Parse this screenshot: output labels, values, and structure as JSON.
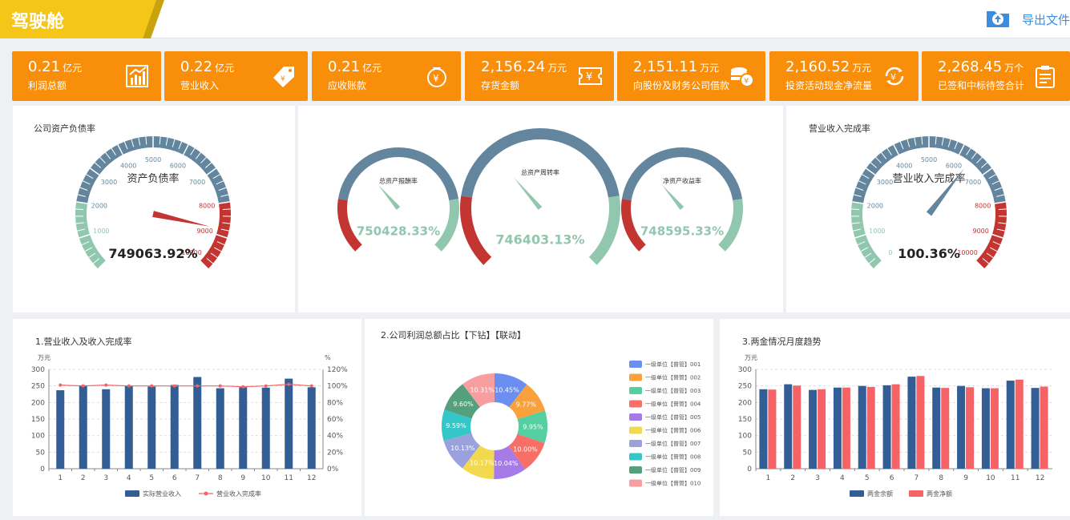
{
  "header": {
    "title": "驾驶舱",
    "export_label": "导出文件",
    "export_icon": "cloud-upload-icon"
  },
  "colors": {
    "accent": "#f98e0b",
    "title_tab": "#f5c518",
    "gauge_green": "#91c7ae",
    "gauge_blue": "#63869e",
    "gauge_red": "#c23531",
    "bar_blue": "#325d95",
    "bar_red": "#f56366"
  },
  "kpis": [
    {
      "value": "0.21",
      "unit": "亿元",
      "label": "利润总额",
      "icon": "bar-chart-icon"
    },
    {
      "value": "0.22",
      "unit": "亿元",
      "label": "营业收入",
      "icon": "price-tag-icon"
    },
    {
      "value": "0.21",
      "unit": "亿元",
      "label": "应收账款",
      "icon": "money-bag-icon"
    },
    {
      "value": "2,156.24",
      "unit": "万元",
      "label": "存货金额",
      "icon": "ticket-icon"
    },
    {
      "value": "2,151.11",
      "unit": "万元",
      "label": "向股份及财务公司借款",
      "icon": "coins-icon"
    },
    {
      "value": "2,160.52",
      "unit": "万元",
      "label": "投资活动现金净流量",
      "icon": "cycle-icon"
    },
    {
      "value": "2,268.45",
      "unit": "万个",
      "label": "已签和中标待签合计",
      "icon": "clipboard-icon"
    }
  ],
  "gauge_left": {
    "title": "公司资产负债率",
    "name": "资产负债率",
    "value_text": "749063.92%",
    "ticks": [
      "0",
      "1000",
      "2000",
      "3000",
      "4000",
      "5000",
      "6000",
      "7000",
      "8000",
      "9000",
      "10000"
    ],
    "pointer_fraction": 0.88
  },
  "gauge_center": [
    {
      "name": "总资产报酬率",
      "value_text": "750428.33%",
      "pointer_fraction": 0.35
    },
    {
      "name": "总资产周转率",
      "value_text": "746403.13%",
      "pointer_fraction": 0.35
    },
    {
      "name": "净资产收益率",
      "value_text": "748595.33%",
      "pointer_fraction": 0.35
    }
  ],
  "gauge_right": {
    "title": "营业收入完成率",
    "name": "营业收入完成率",
    "value_text": "100.36%",
    "ticks": [
      "0",
      "1000",
      "2000",
      "3000",
      "4000",
      "5000",
      "6000",
      "7000",
      "8000",
      "9000",
      "10000"
    ],
    "pointer_fraction": 0.64
  },
  "chart_data": [
    {
      "type": "bar",
      "title": "1.营业收入及收入完成率",
      "ylabel": "万元",
      "ylabel_right": "%",
      "categories": [
        "1",
        "2",
        "3",
        "4",
        "5",
        "6",
        "7",
        "8",
        "9",
        "10",
        "11",
        "12"
      ],
      "yticks": [
        "0",
        "50",
        "100",
        "150",
        "200",
        "250",
        "300"
      ],
      "yticks_right": [
        "0%",
        "20%",
        "40%",
        "60%",
        "80%",
        "100%",
        "120%"
      ],
      "ylim": [
        0,
        300
      ],
      "ylim_right": [
        0,
        120
      ],
      "series": [
        {
          "name": "实际营业收入",
          "values": [
            237,
            252,
            240,
            250,
            248,
            253,
            277,
            243,
            246,
            245,
            272,
            246
          ]
        },
        {
          "name": "营业收入完成率",
          "values": [
            101,
            100,
            101,
            100,
            100,
            100,
            100,
            100,
            99,
            100,
            102,
            100
          ]
        }
      ],
      "legend": "bottom"
    },
    {
      "type": "pie",
      "title": "2.公司利润总额占比【下钻】【联动】",
      "categories": [
        "一级单位【普管】001",
        "一级单位【普管】002",
        "一级单位【普管】003",
        "一级单位【普管】004",
        "一级单位【普管】005",
        "一级单位【普管】006",
        "一级单位【普管】007",
        "一级单位【普管】008",
        "一级单位【普管】009",
        "一级单位【普管】010"
      ],
      "values": [
        10.45,
        9.77,
        9.95,
        10.0,
        10.04,
        10.17,
        10.13,
        9.59,
        9.6,
        10.31
      ],
      "labels": [
        "10.45%",
        "9.77%",
        "9.95%",
        "10.00%",
        "10.04%",
        "10.17%",
        "10.13%",
        "9.59%",
        "9.60%",
        "10.31%"
      ],
      "colors": [
        "#6b8ff0",
        "#f9a13c",
        "#53cfa2",
        "#f76f67",
        "#a67be8",
        "#f2d94e",
        "#9aa1dc",
        "#35c6c8",
        "#55a07c",
        "#f79ea0"
      ],
      "legend": "right"
    },
    {
      "type": "bar",
      "title": "3.两金情况月度趋势",
      "ylabel": "万元",
      "categories": [
        "1",
        "2",
        "3",
        "4",
        "5",
        "6",
        "7",
        "8",
        "9",
        "10",
        "11",
        "12"
      ],
      "yticks": [
        "0",
        "50",
        "100",
        "150",
        "200",
        "250",
        "300"
      ],
      "ylim": [
        0,
        300
      ],
      "series": [
        {
          "name": "两金余额",
          "values": [
            240,
            255,
            238,
            245,
            250,
            252,
            278,
            245,
            250,
            243,
            266,
            244
          ]
        },
        {
          "name": "两金净额",
          "values": [
            239,
            251,
            240,
            245,
            247,
            255,
            280,
            244,
            246,
            243,
            269,
            248
          ]
        }
      ],
      "legend": "bottom"
    }
  ]
}
